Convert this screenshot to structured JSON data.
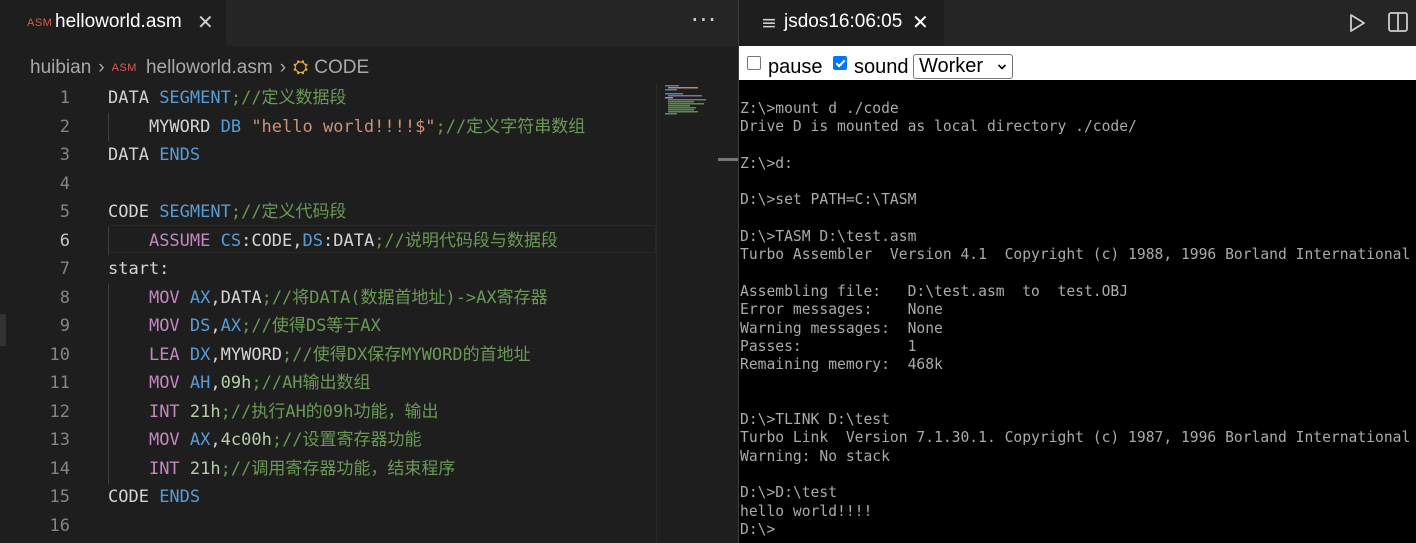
{
  "editor": {
    "tab": {
      "badge": "ASM",
      "title": "helloworld.asm",
      "close": "✕"
    },
    "more": "···",
    "breadcrumb": {
      "folder": "huibian",
      "file": "helloworld.asm",
      "symbol": "CODE",
      "badge": "ASM"
    },
    "active_line": 6,
    "lines": [
      [
        [
          "t",
          "DATA "
        ],
        [
          "k",
          "SEGMENT"
        ],
        [
          "c",
          ";//定义数据段"
        ]
      ],
      [
        [
          "t",
          "    MYWORD "
        ],
        [
          "k",
          "DB "
        ],
        [
          "s",
          "\"hello world!!!!$\""
        ],
        [
          "c",
          ";//定义字符串数组"
        ]
      ],
      [
        [
          "t",
          "DATA "
        ],
        [
          "k",
          "ENDS"
        ]
      ],
      [],
      [
        [
          "t",
          "CODE "
        ],
        [
          "k",
          "SEGMENT"
        ],
        [
          "c",
          ";//定义代码段"
        ]
      ],
      [
        [
          "t",
          "    "
        ],
        [
          "r",
          "ASSUME "
        ],
        [
          "k",
          "CS"
        ],
        [
          "t",
          ":CODE,"
        ],
        [
          "k",
          "DS"
        ],
        [
          "t",
          ":DATA"
        ],
        [
          "c",
          ";//说明代码段与数据段"
        ]
      ],
      [
        [
          "t",
          "start:"
        ]
      ],
      [
        [
          "t",
          "    "
        ],
        [
          "r",
          "MOV "
        ],
        [
          "k",
          "AX"
        ],
        [
          "t",
          ",DATA"
        ],
        [
          "c",
          ";//将DATA(数据首地址)->AX寄存器"
        ]
      ],
      [
        [
          "t",
          "    "
        ],
        [
          "r",
          "MOV "
        ],
        [
          "k",
          "DS"
        ],
        [
          "t",
          ","
        ],
        [
          "k",
          "AX"
        ],
        [
          "c",
          ";//使得DS等于AX"
        ]
      ],
      [
        [
          "t",
          "    "
        ],
        [
          "r",
          "LEA "
        ],
        [
          "k",
          "DX"
        ],
        [
          "t",
          ",MYWORD"
        ],
        [
          "c",
          ";//使得DX保存MYWORD的首地址"
        ]
      ],
      [
        [
          "t",
          "    "
        ],
        [
          "r",
          "MOV "
        ],
        [
          "k",
          "AH"
        ],
        [
          "t",
          ","
        ],
        [
          "n",
          "09h"
        ],
        [
          "c",
          ";//AH输出数组"
        ]
      ],
      [
        [
          "t",
          "    "
        ],
        [
          "r",
          "INT "
        ],
        [
          "n",
          "21h"
        ],
        [
          "c",
          ";//执行AH的09h功能，输出"
        ]
      ],
      [
        [
          "t",
          "    "
        ],
        [
          "r",
          "MOV "
        ],
        [
          "k",
          "AX"
        ],
        [
          "t",
          ","
        ],
        [
          "n",
          "4c00h"
        ],
        [
          "c",
          ";//设置寄存器功能"
        ]
      ],
      [
        [
          "t",
          "    "
        ],
        [
          "r",
          "INT "
        ],
        [
          "n",
          "21h"
        ],
        [
          "c",
          ";//调用寄存器功能，结束程序"
        ]
      ],
      [
        [
          "t",
          "CODE "
        ],
        [
          "k",
          "ENDS"
        ]
      ],
      []
    ],
    "line_numbers": [
      "1",
      "2",
      "3",
      "4",
      "5",
      "6",
      "7",
      "8",
      "9",
      "10",
      "11",
      "12",
      "13",
      "14",
      "15",
      "16"
    ]
  },
  "dos": {
    "tab": {
      "icon": "≡",
      "title": "jsdos16:06:05",
      "close": "✕"
    },
    "controls": {
      "pause_label": "pause",
      "pause_checked": false,
      "sound_label": "sound",
      "sound_checked": true,
      "select_value": "Worker"
    },
    "terminal_lines": [
      "Z:\\>mount d ./code",
      "Drive D is mounted as local directory ./code/",
      "",
      "Z:\\>d:",
      "",
      "D:\\>set PATH=C:\\TASM",
      "",
      "D:\\>TASM D:\\test.asm",
      "Turbo Assembler  Version 4.1  Copyright (c) 1988, 1996 Borland International",
      "",
      "Assembling file:   D:\\test.asm  to  test.OBJ",
      "Error messages:    None",
      "Warning messages:  None",
      "Passes:            1",
      "Remaining memory:  468k",
      "",
      "",
      "D:\\>TLINK D:\\test",
      "Turbo Link  Version 7.1.30.1. Copyright (c) 1987, 1996 Borland International",
      "Warning: No stack",
      "",
      "D:\\>D:\\test",
      "hello world!!!!",
      "D:\\>"
    ]
  },
  "colors": {
    "keyword": "#569cd6",
    "instruction": "#c586c0",
    "string": "#ce9178",
    "comment": "#6a9955",
    "number": "#b5cea8"
  },
  "icons": [
    "asm-file-icon",
    "chevron-right-icon",
    "symbol-code-icon",
    "close-icon",
    "more-icon",
    "preview-icon",
    "run-icon",
    "split-editor-icon",
    "chevron-down-icon"
  ]
}
